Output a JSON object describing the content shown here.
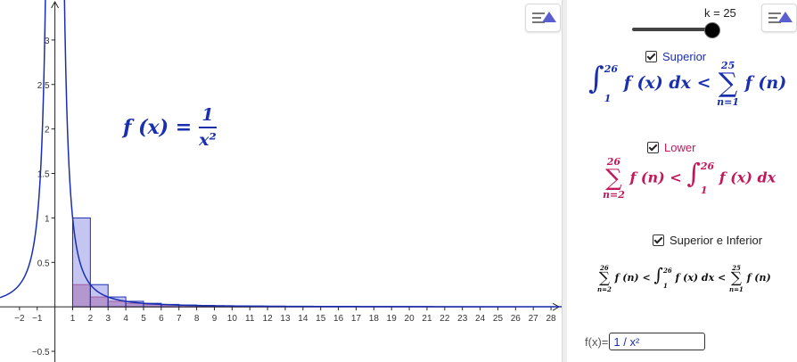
{
  "graph": {
    "function": "1/x^2",
    "k": 25,
    "x_range": [
      -3.1,
      28.6
    ],
    "y_range": [
      -0.62,
      3.45
    ],
    "x_ticks": [
      "−2",
      "−1",
      "1",
      "2",
      "3",
      "4",
      "5",
      "6",
      "7",
      "8",
      "9",
      "10",
      "11",
      "12",
      "13",
      "14",
      "15",
      "16",
      "17",
      "18",
      "19",
      "20",
      "21",
      "22",
      "23",
      "24",
      "25",
      "26",
      "27",
      "28"
    ],
    "x_tick_values": [
      -2,
      -1,
      1,
      2,
      3,
      4,
      5,
      6,
      7,
      8,
      9,
      10,
      11,
      12,
      13,
      14,
      15,
      16,
      17,
      18,
      19,
      20,
      21,
      22,
      23,
      24,
      25,
      26,
      27,
      28
    ],
    "y_ticks": [
      "−0.5",
      "0.5",
      "1",
      "1.5",
      "2",
      "2.5",
      "3"
    ],
    "y_tick_values": [
      -0.5,
      0.5,
      1,
      1.5,
      2,
      2.5,
      3
    ],
    "formula_lhs": "f (x) =",
    "formula_num": "1",
    "formula_den": "x²"
  },
  "colors": {
    "curve": "#1a2fb0",
    "upper_fill": "#8c8ce6",
    "lower_fill": "#b03060",
    "superior": "#1a2fb0",
    "lower": "#c2185b"
  },
  "sidebar": {
    "slider_label": "k = 25",
    "slider_value": 25,
    "slider_fraction": 0.93,
    "superior_label": "Superior",
    "superior_checked": true,
    "superior_formula": {
      "int_upper": "26",
      "int_lower": "1",
      "integrand": "f (x) dx <",
      "sum_upper": "25",
      "sum_lower": "n=1",
      "summand": "f (n)"
    },
    "lower_label": "Lower",
    "lower_checked": true,
    "lower_formula": {
      "sum_upper": "26",
      "sum_lower": "n=2",
      "summand": "f (n) <",
      "int_upper": "26",
      "int_lower": "1",
      "integrand": "f (x) dx"
    },
    "both_label": "Superior e Inferior",
    "both_checked": true,
    "both_formula": {
      "sum1_upper": "26",
      "sum1_lower": "n=2",
      "summand1": "f (n) <",
      "int_upper": "26",
      "int_lower": "1",
      "integrand": "f (x) dx <",
      "sum2_upper": "25",
      "sum2_lower": "n=1",
      "summand2": "f (n)"
    },
    "input_label": "f(x)=",
    "input_value": "1 / x²"
  }
}
